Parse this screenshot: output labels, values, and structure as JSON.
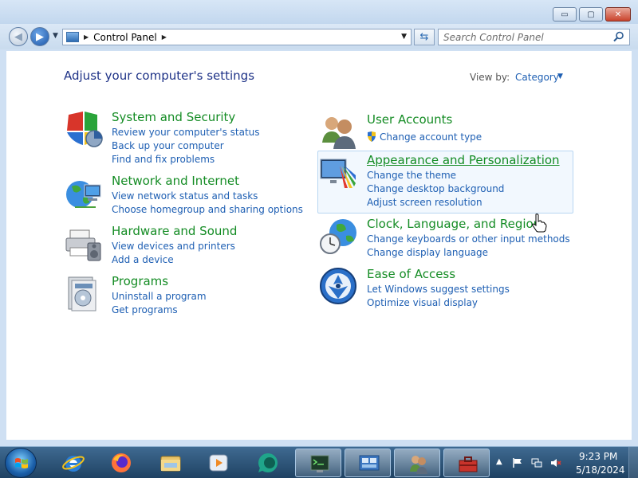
{
  "window": {
    "controls": {
      "minimize": "▭",
      "maximize": "▢",
      "close": "✕"
    }
  },
  "nav": {
    "breadcrumb": "Control Panel",
    "search_placeholder": "Search Control Panel"
  },
  "main": {
    "title": "Adjust your computer's settings",
    "view_by_label": "View by:",
    "view_by_value": "Category"
  },
  "categories": [
    {
      "title": "System and Security",
      "icon": "shield-icon",
      "links": [
        "Review your computer's status",
        "Back up your computer",
        "Find and fix problems"
      ]
    },
    {
      "title": "Network and Internet",
      "icon": "network-globe-icon",
      "links": [
        "View network status and tasks",
        "Choose homegroup and sharing options"
      ]
    },
    {
      "title": "Hardware and Sound",
      "icon": "printer-speaker-icon",
      "links": [
        "View devices and printers",
        "Add a device"
      ]
    },
    {
      "title": "Programs",
      "icon": "programs-icon",
      "links": [
        "Uninstall a program",
        "Get programs"
      ]
    },
    {
      "title": "User Accounts",
      "icon": "users-icon",
      "links": [
        "Change account type"
      ]
    },
    {
      "title": "Appearance and Personalization",
      "icon": "monitor-colors-icon",
      "links": [
        "Change the theme",
        "Change desktop background",
        "Adjust screen resolution"
      ]
    },
    {
      "title": "Clock, Language, and Region",
      "icon": "clock-globe-icon",
      "links": [
        "Change keyboards or other input methods",
        "Change display language"
      ]
    },
    {
      "title": "Ease of Access",
      "icon": "ease-of-access-icon",
      "links": [
        "Let Windows suggest settings",
        "Optimize visual display"
      ]
    }
  ],
  "taskbar": {
    "time": "9:23 PM",
    "date": "5/18/2024",
    "pinned": [
      "ie-icon",
      "firefox-icon",
      "explorer-icon",
      "media-player-icon",
      "chat-app-icon",
      "terminal-app-icon",
      "control-panel-app-icon",
      "users-app-icon",
      "toolbox-app-icon"
    ]
  },
  "colors": {
    "category_title": "#148c24",
    "link": "#1e5fb3",
    "page_title": "#1e3287"
  }
}
